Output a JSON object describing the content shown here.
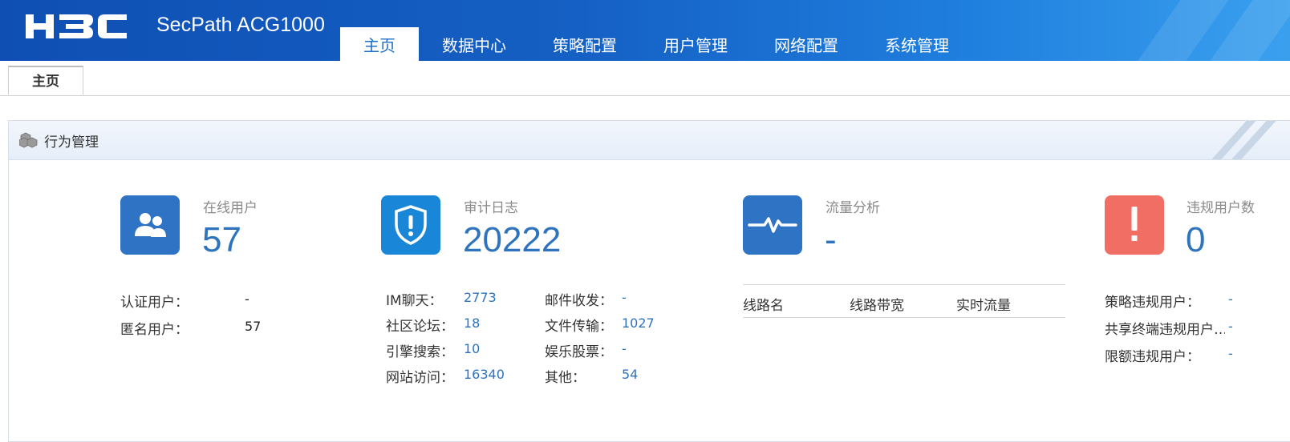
{
  "header": {
    "brand": "H3C",
    "product": "SecPath ACG1000",
    "nav": [
      "主页",
      "数据中心",
      "策略配置",
      "用户管理",
      "网络配置",
      "系统管理"
    ],
    "active_nav": "主页"
  },
  "page_tabs": [
    "主页"
  ],
  "panel": {
    "title": "行为管理",
    "online_users": {
      "label": "在线用户",
      "value": "57",
      "rows": [
        {
          "key": "认证用户：",
          "value": "-"
        },
        {
          "key": "匿名用户：",
          "value": "57"
        }
      ]
    },
    "audit_log": {
      "label": "审计日志",
      "value": "20222",
      "rows_left": [
        {
          "key": "IM聊天：",
          "value": "2773"
        },
        {
          "key": "社区论坛：",
          "value": "18"
        },
        {
          "key": "引擎搜索：",
          "value": "10"
        },
        {
          "key": "网站访问：",
          "value": "16340"
        }
      ],
      "rows_right": [
        {
          "key": "邮件收发：",
          "value": "-"
        },
        {
          "key": "文件传输：",
          "value": "1027"
        },
        {
          "key": "娱乐股票：",
          "value": "-"
        },
        {
          "key": "其他：",
          "value": "54"
        }
      ]
    },
    "traffic": {
      "label": "流量分析",
      "value": "-",
      "columns": [
        "线路名",
        "线路带宽",
        "实时流量"
      ]
    },
    "violations": {
      "label": "违规用户数",
      "value": "0",
      "rows": [
        {
          "key": "策略违规用户：",
          "value": "-"
        },
        {
          "key": "共享终端违规用户…",
          "value": "-"
        },
        {
          "key": "限额违规用户：",
          "value": "-"
        }
      ]
    }
  },
  "colors": {
    "accent": "#2e73bd",
    "header_blue": "#1560c4",
    "icon_blue": "#2f73c4",
    "icon_blue_bright": "#1a86d8",
    "alert_red": "#f06e63"
  }
}
